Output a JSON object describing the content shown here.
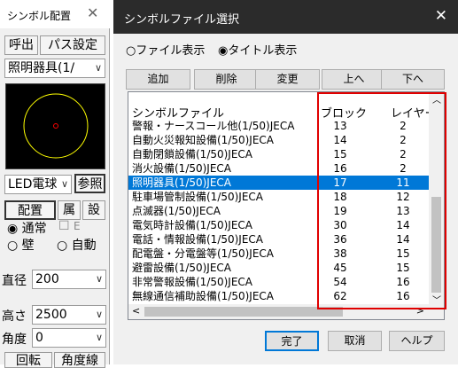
{
  "palette": {
    "title": "シンボル配置",
    "close": "✕",
    "call_label": "呼出",
    "path_setting_label": "パス設定",
    "category_value": "照明器具(1/",
    "led_value": "LED電球",
    "ref_label": "参照",
    "place_label": "配置",
    "attr_label": "属",
    "set_label": "設",
    "radio_normal": "通常",
    "check_e": "E",
    "radio_wall": "壁",
    "radio_auto": "自動",
    "diameter_label": "直径",
    "diameter_value": "200",
    "height_label": "高さ",
    "height_value": "2500",
    "angle_label": "角度",
    "angle_value": "0",
    "rotate_label": "回転",
    "anglelines_label": "角度線"
  },
  "dialog": {
    "title": "シンボルファイル選択",
    "close": "✕",
    "radio_file": "ファイル表示",
    "radio_title": "タイトル表示",
    "add_label": "追加",
    "delete_label": "削除",
    "change_label": "変更",
    "up_label": "上へ",
    "down_label": "下へ",
    "ok_label": "完了",
    "cancel_label": "取消",
    "help_label": "ヘルプ",
    "columns": {
      "file": "シンボルファイル",
      "block": "ブロック",
      "layer": "レイヤー"
    },
    "rows": [
      {
        "name": "警報・ナースコール他(1/50)JECA",
        "block": "13",
        "layer": "2"
      },
      {
        "name": "自動火災報知設備(1/50)JECA",
        "block": "14",
        "layer": "2"
      },
      {
        "name": "自動閉鎖設備(1/50)JECA",
        "block": "15",
        "layer": "2"
      },
      {
        "name": "消火設備(1/50)JECA",
        "block": "16",
        "layer": "2"
      },
      {
        "name": "照明器具(1/50)JECA",
        "block": "17",
        "layer": "11"
      },
      {
        "name": "駐車場管制設備(1/50)JECA",
        "block": "18",
        "layer": "12"
      },
      {
        "name": "点滅器(1/50)JECA",
        "block": "19",
        "layer": "13"
      },
      {
        "name": "電気時計設備(1/50)JECA",
        "block": "30",
        "layer": "14"
      },
      {
        "name": "電話・情報設備(1/50)JECA",
        "block": "36",
        "layer": "14"
      },
      {
        "name": "配電盤・分電盤等(1/50)JECA",
        "block": "38",
        "layer": "15"
      },
      {
        "name": "避雷設備(1/50)JECA",
        "block": "45",
        "layer": "15"
      },
      {
        "name": "非常警報設備(1/50)JECA",
        "block": "54",
        "layer": "16"
      },
      {
        "name": "無線通信補助設備(1/50)JECA",
        "block": "62",
        "layer": "16"
      }
    ]
  },
  "colors": {
    "selection": "#0078d7",
    "highlight_box": "#e00000",
    "symbol_circle": "#ffff00",
    "symbol_center": "#ff0000"
  }
}
